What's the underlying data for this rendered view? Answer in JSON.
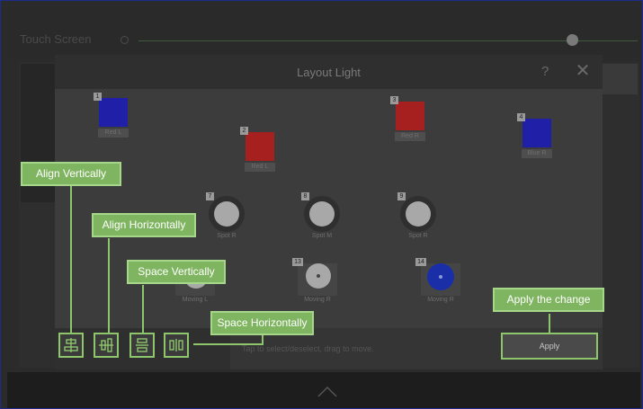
{
  "app": {
    "screen_title": "Touch Screen"
  },
  "dialog": {
    "title": "Layout Light",
    "help_label": "?",
    "close_label": "✕",
    "hint": "Tap to select/deselect, drag to move.",
    "apply_label": "Apply"
  },
  "fixtures": [
    {
      "num": "1",
      "label": "Red L",
      "color": "#1f1fa8"
    },
    {
      "num": "2",
      "label": "Red L",
      "color": "#a62020"
    },
    {
      "num": "3",
      "label": "Red R",
      "color": "#a62020"
    },
    {
      "num": "4",
      "label": "Blue R",
      "color": "#1f1fa8"
    },
    {
      "num": "7",
      "label": "Spot R"
    },
    {
      "num": "8",
      "label": "Spot M"
    },
    {
      "num": "9",
      "label": "Spot R"
    },
    {
      "num": "",
      "label": "Moving L"
    },
    {
      "num": "13",
      "label": "Moving R"
    },
    {
      "num": "14",
      "label": "Moving R",
      "color": "#1a2ea8"
    }
  ],
  "callouts": {
    "align_vertically": "Align Vertically",
    "align_horizontally": "Align Horizontally",
    "space_vertically": "Space Vertically",
    "space_horizontally": "Space Horizontally",
    "apply_change": "Apply the change"
  },
  "icons": {
    "align_vertically": "align-vertical-icon",
    "align_horizontally": "align-horizontal-icon",
    "space_vertically": "space-vertical-icon",
    "space_horizontally": "space-horizontal-icon",
    "chevron": "chevron-up-icon"
  },
  "colors": {
    "callout_fill": "#7fb560",
    "callout_border": "#a6d689"
  }
}
